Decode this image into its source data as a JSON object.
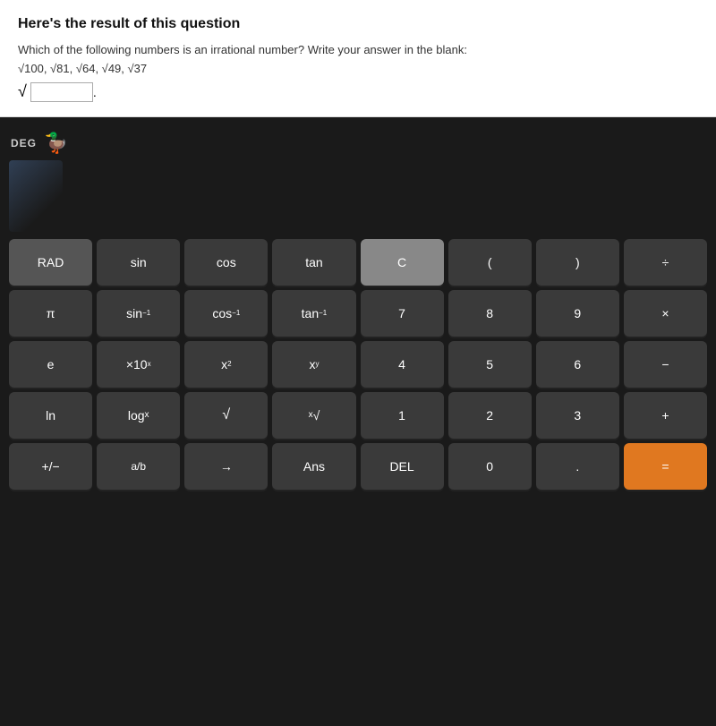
{
  "header": {
    "title": "Here's the result of this question",
    "question": "Which of the following numbers is an irrational number? Write your answer in the blank:",
    "numbers": "√100, √81, √64, √49, √37",
    "answer_prefix": "√"
  },
  "calculator": {
    "mode": "DEG",
    "duck_emoji": "🦆",
    "rows": [
      [
        {
          "label": "RAD",
          "type": "medium-gray"
        },
        {
          "label": "sin",
          "type": "dark"
        },
        {
          "label": "cos",
          "type": "dark"
        },
        {
          "label": "tan",
          "type": "dark"
        },
        {
          "label": "C",
          "type": "clear-btn"
        },
        {
          "label": "(",
          "type": "dark"
        },
        {
          "label": ")",
          "type": "dark"
        },
        {
          "label": "÷",
          "type": "dark"
        }
      ],
      [
        {
          "label": "π",
          "type": "dark"
        },
        {
          "label": "sin⁻¹",
          "type": "dark"
        },
        {
          "label": "cos⁻¹",
          "type": "dark"
        },
        {
          "label": "tan⁻¹",
          "type": "dark"
        },
        {
          "label": "7",
          "type": "dark"
        },
        {
          "label": "8",
          "type": "dark"
        },
        {
          "label": "9",
          "type": "dark"
        },
        {
          "label": "×",
          "type": "dark"
        }
      ],
      [
        {
          "label": "e",
          "type": "dark"
        },
        {
          "label": "×10ˣ",
          "type": "dark"
        },
        {
          "label": "x²",
          "type": "dark"
        },
        {
          "label": "xʸ",
          "type": "dark"
        },
        {
          "label": "4",
          "type": "dark"
        },
        {
          "label": "5",
          "type": "dark"
        },
        {
          "label": "6",
          "type": "dark"
        },
        {
          "label": "−",
          "type": "dark"
        }
      ],
      [
        {
          "label": "ln",
          "type": "dark"
        },
        {
          "label": "log x",
          "type": "dark"
        },
        {
          "label": "√",
          "type": "dark"
        },
        {
          "label": "ˣ√",
          "type": "dark"
        },
        {
          "label": "1",
          "type": "dark"
        },
        {
          "label": "2",
          "type": "dark"
        },
        {
          "label": "3",
          "type": "dark"
        },
        {
          "label": "+",
          "type": "dark"
        }
      ],
      [
        {
          "label": "+/−",
          "type": "dark"
        },
        {
          "label": "a/b",
          "type": "dark"
        },
        {
          "label": "→",
          "type": "dark"
        },
        {
          "label": "Ans",
          "type": "dark"
        },
        {
          "label": "DEL",
          "type": "dark"
        },
        {
          "label": "0",
          "type": "dark"
        },
        {
          "label": ".",
          "type": "dark"
        },
        {
          "label": "=",
          "type": "orange"
        }
      ]
    ]
  }
}
